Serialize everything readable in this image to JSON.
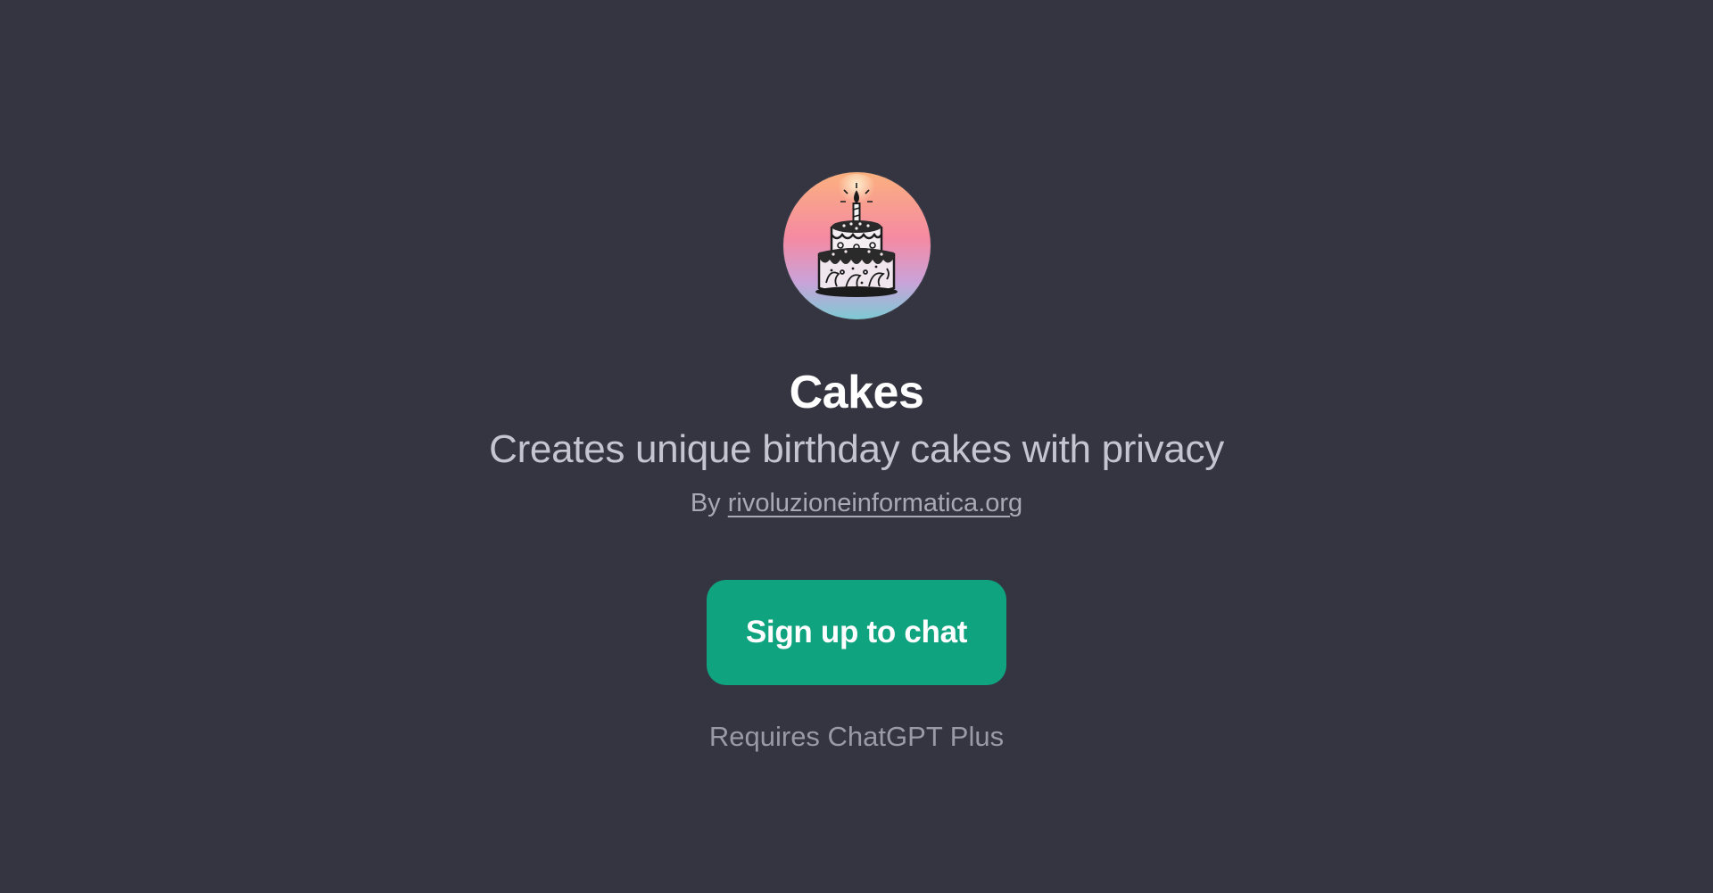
{
  "gpt": {
    "avatar_icon": "birthday-cake-icon",
    "name": "Cakes",
    "description": "Creates unique birthday cakes with privacy",
    "by_prefix": "By",
    "author_link": "rivoluzioneinformatica.org"
  },
  "actions": {
    "signup_label": "Sign up to chat",
    "requires_note": "Requires ChatGPT Plus"
  },
  "colors": {
    "background": "#343541",
    "accent": "#10a37f"
  }
}
